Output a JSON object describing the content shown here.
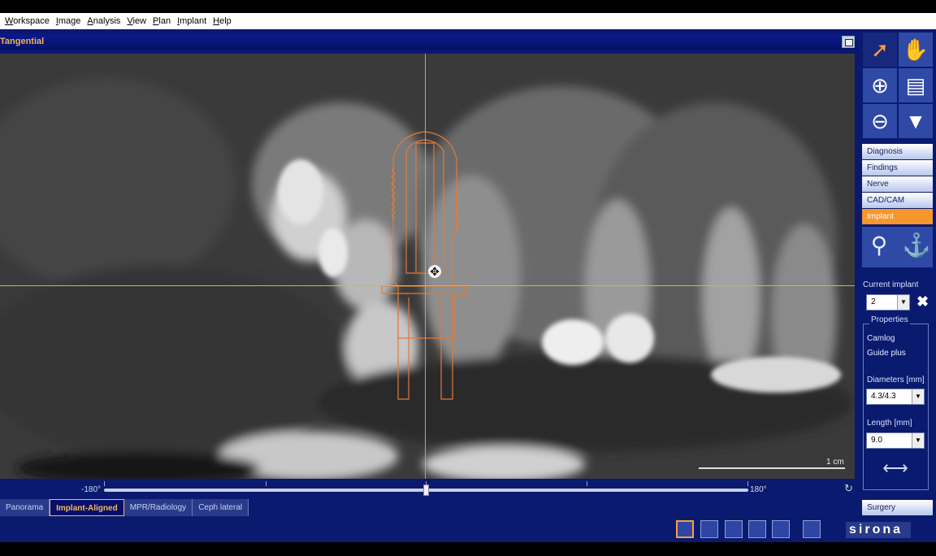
{
  "menu": [
    "Workspace",
    "Image",
    "Analysis",
    "View",
    "Plan",
    "Implant",
    "Help"
  ],
  "view": {
    "title": "Tangential",
    "scale_label": "1 cm",
    "slider_min_label": "-180°",
    "slider_max_label": "180°",
    "slider_value_fraction": 0.5
  },
  "tabs": [
    {
      "label": "Panorama",
      "active": false
    },
    {
      "label": "Implant-Aligned",
      "active": true
    },
    {
      "label": "MPR/Radiology",
      "active": false
    },
    {
      "label": "Ceph lateral",
      "active": false
    }
  ],
  "side_nav": [
    "Diagnosis",
    "Findings",
    "Nerve",
    "CAD/CAM",
    "Implant"
  ],
  "side_nav_active": "Implant",
  "implant": {
    "current_label": "Current implant",
    "current_value": "2",
    "properties_label": "Properties",
    "manufacturer": "Camlog",
    "line": "Guide plus",
    "diameter_label": "Diameters [mm]",
    "diameter_value": "4.3/4.3",
    "length_label": "Length [mm]",
    "length_value": "9.0"
  },
  "surgery_label": "Surgery",
  "brand": "sirona",
  "colors": {
    "accent": "#f7962c",
    "frame": "#0a1a6e",
    "implant_outline": "#e07a3a"
  },
  "icons": {
    "select_tool": "arrow-cursor-icon",
    "pan_tool": "hand-icon",
    "zoom_in": "zoom-in-icon",
    "zoom_out": "zoom-out-icon",
    "slice_up": "slice-up-icon",
    "slice_down": "slice-down-icon"
  }
}
